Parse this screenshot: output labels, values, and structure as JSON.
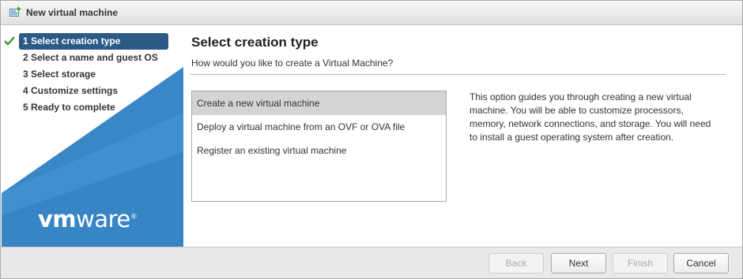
{
  "window": {
    "title": "New virtual machine",
    "icon": "new-vm-icon"
  },
  "sidebar": {
    "steps": [
      {
        "label": "1  Select creation type",
        "active": true,
        "completed": true
      },
      {
        "label": "2  Select a name and guest OS",
        "active": false
      },
      {
        "label": "3  Select storage",
        "active": false
      },
      {
        "label": "4  Customize settings",
        "active": false
      },
      {
        "label": "5  Ready to complete",
        "active": false
      }
    ],
    "logo": {
      "vm": "vm",
      "ware": "ware",
      "registered": "®"
    }
  },
  "main": {
    "title": "Select creation type",
    "subtitle": "How would you like to create a Virtual Machine?",
    "options": [
      {
        "label": "Create a new virtual machine",
        "selected": true
      },
      {
        "label": "Deploy a virtual machine from an OVF or OVA file",
        "selected": false
      },
      {
        "label": "Register an existing virtual machine",
        "selected": false
      }
    ],
    "description": "This option guides you through creating a new virtual machine. You will be able to customize processors, memory, network connections, and storage. You will need to install a guest operating system after creation."
  },
  "footer": {
    "back_label": "Back",
    "next_label": "Next",
    "finish_label": "Finish",
    "cancel_label": "Cancel"
  },
  "colors": {
    "accent": "#2b5a87",
    "sidebar_blue": "#3a87c8",
    "check_green": "#3d9a2f",
    "selected_row": "#d4d4d4"
  }
}
